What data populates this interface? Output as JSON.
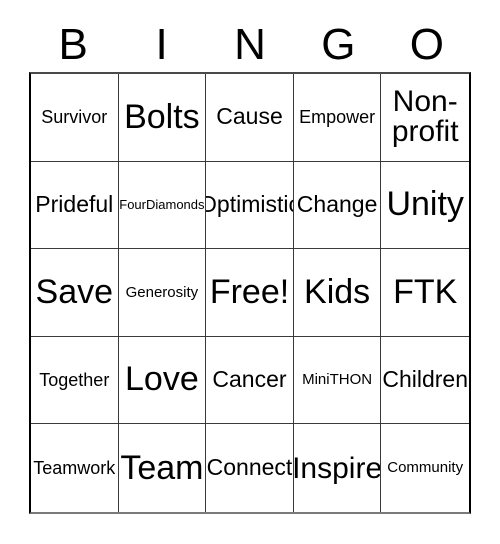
{
  "card": {
    "title": "BINGO",
    "header_letters": [
      "B",
      "I",
      "N",
      "G",
      "O"
    ],
    "grid_size": "5x5",
    "free_space": "Free!",
    "colors": {
      "text": "#000000",
      "background": "#ffffff",
      "grid_line": "#3a3a3a",
      "outer_border": "#000000"
    },
    "rows": [
      [
        {
          "label": "Survivor",
          "size": "sm"
        },
        {
          "label": "Bolts",
          "size": "xl"
        },
        {
          "label": "Cause",
          "size": "md"
        },
        {
          "label": "Empower",
          "size": "sm"
        },
        {
          "label": "Non-profit",
          "size": "wrap"
        }
      ],
      [
        {
          "label": "Prideful",
          "size": "md"
        },
        {
          "label": "FourDiamonds",
          "size": "xxs"
        },
        {
          "label": "Optimistic",
          "size": "md"
        },
        {
          "label": "Change",
          "size": "md"
        },
        {
          "label": "Unity",
          "size": "xl"
        }
      ],
      [
        {
          "label": "Save",
          "size": "xl"
        },
        {
          "label": "Generosity",
          "size": "xs"
        },
        {
          "label": "Free!",
          "size": "xl"
        },
        {
          "label": "Kids",
          "size": "xl"
        },
        {
          "label": "FTK",
          "size": "xl"
        }
      ],
      [
        {
          "label": "Together",
          "size": "sm"
        },
        {
          "label": "Love",
          "size": "xl"
        },
        {
          "label": "Cancer",
          "size": "md"
        },
        {
          "label": "MiniTHON",
          "size": "xs"
        },
        {
          "label": "Children",
          "size": "md"
        }
      ],
      [
        {
          "label": "Teamwork",
          "size": "sm"
        },
        {
          "label": "Team",
          "size": "xl"
        },
        {
          "label": "Connect",
          "size": "md"
        },
        {
          "label": "Inspire",
          "size": "lg"
        },
        {
          "label": "Community",
          "size": "xs"
        }
      ]
    ]
  }
}
